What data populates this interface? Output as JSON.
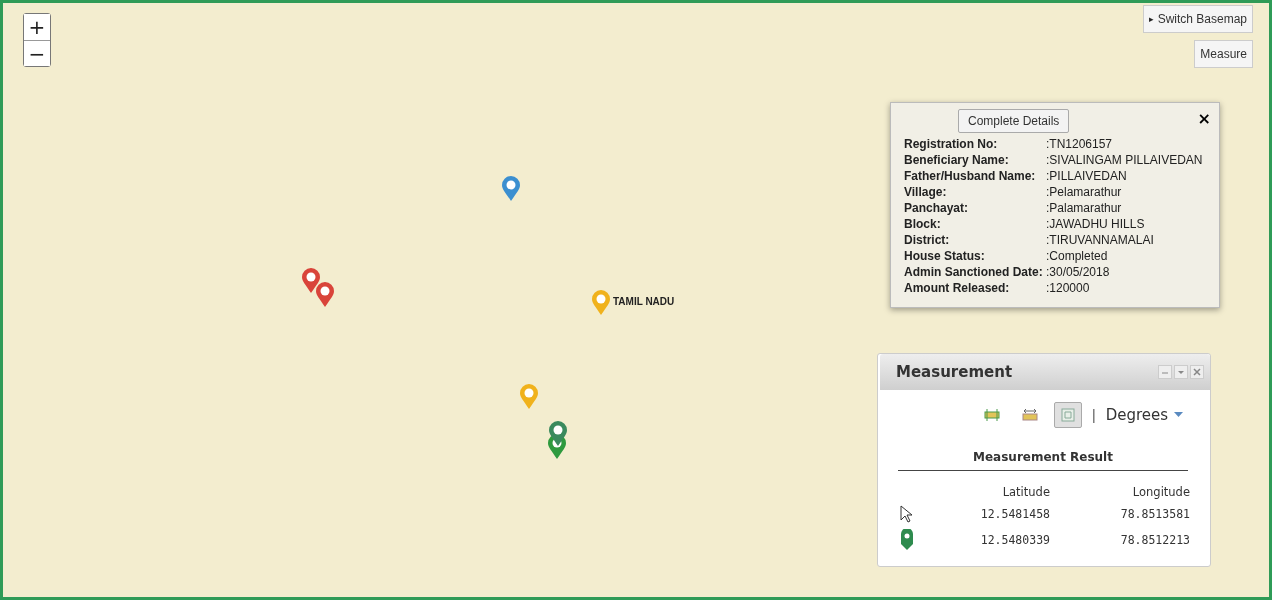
{
  "zoom_controls": [
    "+",
    "−"
  ],
  "basemap_button": {
    "arrow": "▸",
    "label": "Switch Basemap"
  },
  "measure_button": "Measure",
  "markers": [
    {
      "color": "#3b8fd0"
    },
    {
      "color": "#d9443a"
    },
    {
      "color": "#d9443a"
    },
    {
      "color": "#f0b21c"
    },
    {
      "color": "#f0b21c"
    },
    {
      "color": "#2e9a3e"
    },
    {
      "color": "#3a8a5e"
    }
  ],
  "place_label": "TAMIL NADU",
  "popup": {
    "button": "Complete Details",
    "close": "×",
    "rows": [
      {
        "label": "Registration No:",
        "value": ":TN1206157"
      },
      {
        "label": "Beneficiary Name:",
        "value": ":SIVALINGAM PILLAIVEDAN"
      },
      {
        "label": "Father/Husband Name:",
        "value": ":PILLAIVEDAN"
      },
      {
        "label": "Village:",
        "value": ":Pelamarathur"
      },
      {
        "label": "Panchayat:",
        "value": ":Palamarathur"
      },
      {
        "label": "Block:",
        "value": ":JAWADHU HILLS"
      },
      {
        "label": "District:",
        "value": ":TIRUVANNAMALAI"
      },
      {
        "label": "House Status:",
        "value": ":Completed"
      },
      {
        "label": "Admin Sanctioned Date:",
        "value": ":30/05/2018"
      },
      {
        "label": "Amount Released:",
        "value": ":120000"
      }
    ]
  },
  "measurement": {
    "title": "Measurement",
    "tools": [
      {
        "kind": "area",
        "selected": false
      },
      {
        "kind": "distance",
        "selected": false
      },
      {
        "kind": "location",
        "selected": true
      }
    ],
    "separator": "|",
    "unit": "Degrees",
    "result_title": "Measurement Result",
    "columns": [
      "Latitude",
      "Longitude"
    ],
    "rows": [
      {
        "kind": "cursor",
        "latitude": "12.5481458",
        "longitude": "78.8513581"
      },
      {
        "kind": "pin",
        "latitude": "12.5480339",
        "longitude": "78.8512213"
      }
    ]
  }
}
